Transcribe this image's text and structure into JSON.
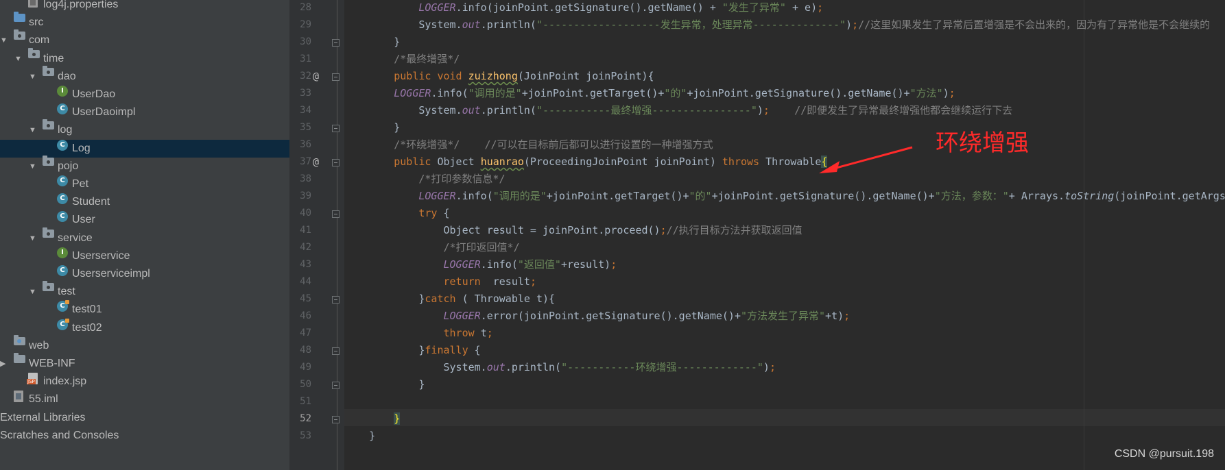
{
  "tree": [
    {
      "label": "log4j.properties",
      "indent": 1,
      "icon": "file-props",
      "open": null,
      "sel": false
    },
    {
      "label": "src",
      "indent": 0,
      "icon": "folder-src",
      "open": null,
      "sel": false
    },
    {
      "label": "com",
      "indent": 0,
      "icon": "package",
      "open": true,
      "sel": false
    },
    {
      "label": "time",
      "indent": 1,
      "icon": "package",
      "open": true,
      "sel": false
    },
    {
      "label": "dao",
      "indent": 2,
      "icon": "package",
      "open": true,
      "sel": false
    },
    {
      "label": "UserDao",
      "indent": 3,
      "icon": "interface",
      "open": null,
      "sel": false
    },
    {
      "label": "UserDaoimpl",
      "indent": 3,
      "icon": "class",
      "open": null,
      "sel": false
    },
    {
      "label": "log",
      "indent": 2,
      "icon": "package",
      "open": true,
      "sel": false
    },
    {
      "label": "Log",
      "indent": 3,
      "icon": "class",
      "open": null,
      "sel": true
    },
    {
      "label": "pojo",
      "indent": 2,
      "icon": "package",
      "open": true,
      "sel": false
    },
    {
      "label": "Pet",
      "indent": 3,
      "icon": "class",
      "open": null,
      "sel": false
    },
    {
      "label": "Student",
      "indent": 3,
      "icon": "class",
      "open": null,
      "sel": false
    },
    {
      "label": "User",
      "indent": 3,
      "icon": "class",
      "open": null,
      "sel": false
    },
    {
      "label": "service",
      "indent": 2,
      "icon": "package",
      "open": true,
      "sel": false
    },
    {
      "label": "Userservice",
      "indent": 3,
      "icon": "interface",
      "open": null,
      "sel": false
    },
    {
      "label": "Userserviceimpl",
      "indent": 3,
      "icon": "class",
      "open": null,
      "sel": false
    },
    {
      "label": "test",
      "indent": 2,
      "icon": "package",
      "open": true,
      "sel": false
    },
    {
      "label": "test01",
      "indent": 3,
      "icon": "test-class",
      "open": null,
      "sel": false
    },
    {
      "label": "test02",
      "indent": 3,
      "icon": "test-class",
      "open": null,
      "sel": false
    },
    {
      "label": "web",
      "indent": 0,
      "icon": "folder-web",
      "open": null,
      "sel": false
    },
    {
      "label": "WEB-INF",
      "indent": 0,
      "icon": "folder",
      "open": false,
      "sel": false
    },
    {
      "label": "index.jsp",
      "indent": 1,
      "icon": "file-jsp",
      "open": null,
      "sel": false
    },
    {
      "label": "55.iml",
      "indent": 0,
      "icon": "file-iml",
      "open": null,
      "sel": false
    },
    {
      "label": "External Libraries",
      "indent": 0,
      "icon": "none",
      "open": null,
      "sel": false
    },
    {
      "label": "Scratches and Consoles",
      "indent": 0,
      "icon": "none",
      "open": null,
      "sel": false
    }
  ],
  "code": [
    {
      "n": "28",
      "at": false,
      "fold": false,
      "segs": [
        [
          "",
          "            "
        ],
        [
          "lg",
          "LOGGER"
        ],
        [
          "",
          ".info(joinPoint.getSignature().getName() + "
        ],
        [
          "st",
          "\"发生了异常\""
        ],
        [
          "",
          " + e)"
        ],
        [
          "kw",
          ";"
        ]
      ]
    },
    {
      "n": "29",
      "at": false,
      "fold": false,
      "segs": [
        [
          "",
          "            System."
        ],
        [
          "sf",
          "out"
        ],
        [
          "",
          ".println("
        ],
        [
          "st",
          "\"-------------------发生异常，处理异常--------------\""
        ],
        [
          "",
          ")"
        ],
        [
          "kw",
          ";"
        ],
        [
          "cm",
          "//这里如果发生了异常后置增强是不会出来的，因为有了异常他是不会继续的"
        ]
      ]
    },
    {
      "n": "30",
      "at": false,
      "fold": true,
      "segs": [
        [
          "",
          "        }"
        ]
      ]
    },
    {
      "n": "31",
      "at": false,
      "fold": false,
      "segs": [
        [
          "cm",
          "        /*最终增强*/"
        ]
      ]
    },
    {
      "n": "32",
      "at": true,
      "fold": true,
      "segs": [
        [
          "kw",
          "        public void "
        ],
        [
          "fn",
          "zuizhong"
        ],
        [
          "",
          "(JoinPoint joinPoint){"
        ]
      ]
    },
    {
      "n": "33",
      "at": false,
      "fold": false,
      "segs": [
        [
          "lg",
          "        LOGGER"
        ],
        [
          "",
          ".info("
        ],
        [
          "st",
          "\"调用的是\""
        ],
        [
          "",
          "+joinPoint.getTarget()+"
        ],
        [
          "st",
          "\"的\""
        ],
        [
          "",
          "+joinPoint.getSignature().getName()+"
        ],
        [
          "st",
          "\"方法\""
        ],
        [
          "",
          ")"
        ],
        [
          "kw",
          ";"
        ]
      ]
    },
    {
      "n": "34",
      "at": false,
      "fold": false,
      "segs": [
        [
          "",
          "            System."
        ],
        [
          "sf",
          "out"
        ],
        [
          "",
          ".println("
        ],
        [
          "st",
          "\"-----------最终增强----------------\""
        ],
        [
          "",
          ")"
        ],
        [
          "kw",
          ";"
        ],
        [
          "",
          "    "
        ],
        [
          "cm",
          "//即便发生了异常最终增强他都会继续运行下去"
        ]
      ]
    },
    {
      "n": "35",
      "at": false,
      "fold": true,
      "segs": [
        [
          "",
          "        }"
        ]
      ]
    },
    {
      "n": "36",
      "at": false,
      "fold": false,
      "segs": [
        [
          "cm",
          "        /*环绕增强*/    //可以在目标前后都可以进行设置的一种增强方式"
        ]
      ]
    },
    {
      "n": "37",
      "at": true,
      "fold": true,
      "segs": [
        [
          "kw",
          "        public "
        ],
        [
          "",
          "Object "
        ],
        [
          "fn",
          "huanrao"
        ],
        [
          "",
          "(ProceedingJoinPoint joinPoint) "
        ],
        [
          "kw",
          "throws "
        ],
        [
          "",
          "Throwable"
        ],
        [
          "br",
          "{"
        ]
      ]
    },
    {
      "n": "38",
      "at": false,
      "fold": false,
      "segs": [
        [
          "cm",
          "            /*打印参数信息*/"
        ]
      ]
    },
    {
      "n": "39",
      "at": false,
      "fold": false,
      "segs": [
        [
          "lg",
          "            LOGGER"
        ],
        [
          "",
          ".info("
        ],
        [
          "st",
          "\"调用的是\""
        ],
        [
          "",
          "+joinPoint.getTarget()+"
        ],
        [
          "st",
          "\"的\""
        ],
        [
          "",
          "+joinPoint.getSignature().getName()+"
        ],
        [
          "st",
          "\"方法，参数：\""
        ],
        [
          "",
          "+ Arrays."
        ],
        [
          "it",
          "toString"
        ],
        [
          "",
          "(joinPoint.getArgs()))"
        ]
      ]
    },
    {
      "n": "40",
      "at": false,
      "fold": true,
      "segs": [
        [
          "kw",
          "            try "
        ],
        [
          "",
          "{"
        ]
      ]
    },
    {
      "n": "41",
      "at": false,
      "fold": false,
      "segs": [
        [
          "",
          "                Object result = joinPoint.proceed()"
        ],
        [
          "kw",
          ";"
        ],
        [
          "cm",
          "//执行目标方法并获取返回值"
        ]
      ]
    },
    {
      "n": "42",
      "at": false,
      "fold": false,
      "segs": [
        [
          "cm",
          "                /*打印返回值*/"
        ]
      ]
    },
    {
      "n": "43",
      "at": false,
      "fold": false,
      "segs": [
        [
          "lg",
          "                LOGGER"
        ],
        [
          "",
          ".info("
        ],
        [
          "st",
          "\"返回值\""
        ],
        [
          "",
          "+result)"
        ],
        [
          "kw",
          ";"
        ]
      ]
    },
    {
      "n": "44",
      "at": false,
      "fold": false,
      "segs": [
        [
          "kw",
          "                return  "
        ],
        [
          "",
          "result"
        ],
        [
          "kw",
          ";"
        ]
      ]
    },
    {
      "n": "45",
      "at": false,
      "fold": true,
      "segs": [
        [
          "",
          "            }"
        ],
        [
          "kw",
          "catch "
        ],
        [
          "",
          "( Throwable t){"
        ]
      ]
    },
    {
      "n": "46",
      "at": false,
      "fold": false,
      "segs": [
        [
          "lg",
          "                LOGGER"
        ],
        [
          "",
          ".error(joinPoint.getSignature().getName()+"
        ],
        [
          "st",
          "\"方法发生了异常\""
        ],
        [
          "",
          "+t)"
        ],
        [
          "kw",
          ";"
        ]
      ]
    },
    {
      "n": "47",
      "at": false,
      "fold": false,
      "segs": [
        [
          "kw",
          "                throw "
        ],
        [
          "",
          "t"
        ],
        [
          "kw",
          ";"
        ]
      ]
    },
    {
      "n": "48",
      "at": false,
      "fold": true,
      "segs": [
        [
          "",
          "            }"
        ],
        [
          "kw",
          "finally "
        ],
        [
          "",
          "{"
        ]
      ]
    },
    {
      "n": "49",
      "at": false,
      "fold": false,
      "segs": [
        [
          "",
          "                System."
        ],
        [
          "sf",
          "out"
        ],
        [
          "",
          ".println("
        ],
        [
          "st",
          "\"-----------环绕增强-------------\""
        ],
        [
          "",
          ")"
        ],
        [
          "kw",
          ";"
        ]
      ]
    },
    {
      "n": "50",
      "at": false,
      "fold": true,
      "segs": [
        [
          "",
          "            }"
        ]
      ]
    },
    {
      "n": "51",
      "at": false,
      "fold": false,
      "segs": [
        [
          "",
          ""
        ]
      ]
    },
    {
      "n": "52",
      "at": false,
      "fold": true,
      "segs": [
        [
          "",
          "        "
        ],
        [
          "br",
          "}"
        ]
      ]
    },
    {
      "n": "53",
      "at": false,
      "fold": false,
      "segs": [
        [
          "",
          "    }"
        ]
      ]
    }
  ],
  "annotation": {
    "label": "环绕增强",
    "color": "#ff2a2a"
  },
  "watermark": "CSDN @pursuit.198"
}
